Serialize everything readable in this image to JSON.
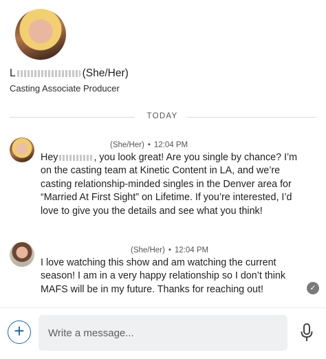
{
  "profile": {
    "name_suffix": "(She/Her)",
    "title": "Casting Associate Producer"
  },
  "divider": {
    "label": "TODAY"
  },
  "messages": [
    {
      "pronouns": "(She/Her)",
      "time": "12:04 PM",
      "text_before": "Hey",
      "text_after": ", you look great! Are you single by chance? I’m on the casting team at Kinetic Content in LA, and we’re casting relationship-minded singles in the Denver area for “Married At First Sight” on Lifetime. If you’re interested, I’d love to give you the details and see what you think!"
    },
    {
      "pronouns": "(She/Her)",
      "time": "12:04 PM",
      "text": "I love watching this show and am watching the current season! I am in a very happy relationship so I don’t think MAFS will be in my future.  Thanks for reaching out!"
    }
  ],
  "compose": {
    "placeholder": "Write a message..."
  },
  "icons": {
    "add": "plus-icon",
    "mic": "microphone-icon",
    "read": "check-icon"
  },
  "colors": {
    "accent": "#0a66c2"
  }
}
